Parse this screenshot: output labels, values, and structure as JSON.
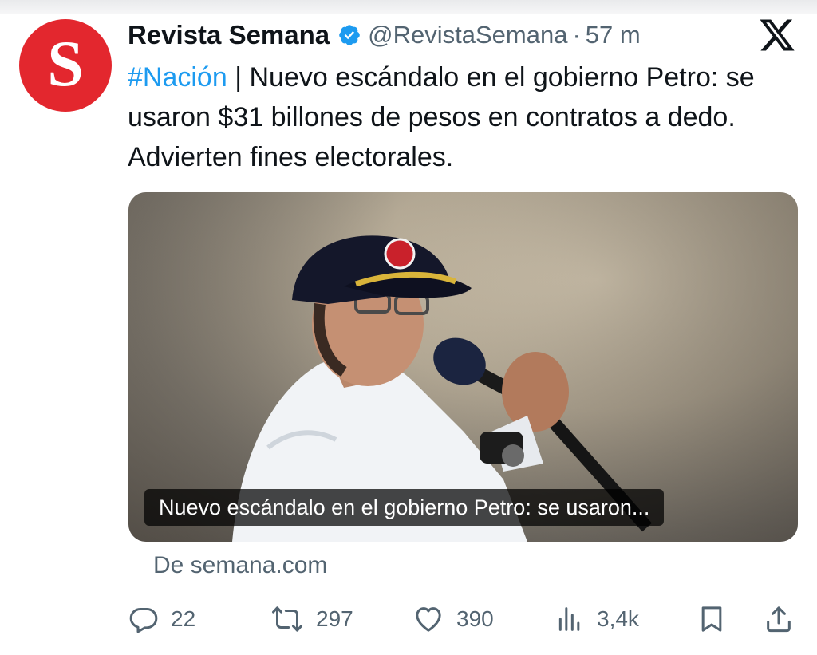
{
  "tweet": {
    "author_name": "Revista Semana",
    "handle": "@RevistaSemana",
    "separator": "·",
    "time": "57 m",
    "avatar_letter": "S",
    "hashtag": "#Nación",
    "text": " | Nuevo escándalo en el gobierno Petro: se usaron $31 billones de pesos en contratos a dedo. Advierten fines electorales.",
    "card_caption": "Nuevo escándalo en el gobierno Petro: se usaron...",
    "card_source": "De semana.com"
  },
  "actions": {
    "replies": "22",
    "reposts": "297",
    "likes": "390",
    "views": "3,4k"
  },
  "icons": {
    "verified": "verified-badge-icon",
    "platform": "x-logo-icon",
    "reply": "reply-icon",
    "repost": "repost-icon",
    "like": "heart-icon",
    "views": "analytics-icon",
    "bookmark": "bookmark-icon",
    "share": "share-icon"
  },
  "colors": {
    "brand_red": "#e3272e",
    "link_blue": "#1d9bf0",
    "text_primary": "#0f1419",
    "text_secondary": "#536471"
  }
}
